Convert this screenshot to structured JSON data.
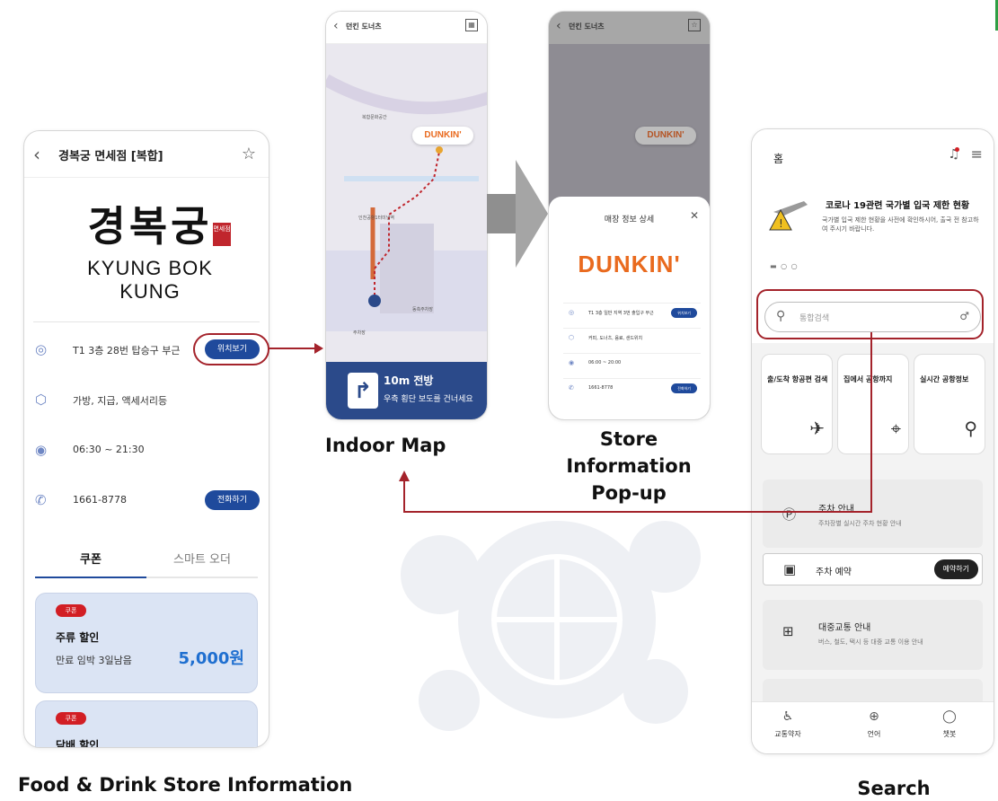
{
  "captions": {
    "food_store": "Food & Drink Store Information",
    "indoor_map": "Indoor Map",
    "store_popup": "Store Information Pop-up",
    "search": "Search"
  },
  "store_screen": {
    "title": "경복궁 면세점 [복합]",
    "logo_korean": "경복궁",
    "logo_seal": "면세점",
    "logo_english": "KYUNG BOK KUNG",
    "rows": [
      {
        "icon": "location-pin-icon",
        "text": "T1 3층 28번 탑승구 부근",
        "button": "위치보기"
      },
      {
        "icon": "box-icon",
        "text": "가방, 지급, 액세서리등",
        "button": ""
      },
      {
        "icon": "clock-icon",
        "text": "06:30 ~ 21:30",
        "button": ""
      },
      {
        "icon": "phone-icon",
        "text": "1661-8778",
        "button": "전화하기"
      }
    ],
    "tabs": [
      "쿠폰",
      "스마트 오더"
    ],
    "coupons": [
      {
        "tag": "쿠폰",
        "title": "주류 할인",
        "subtitle": "만료 임박  3일남음",
        "amount": "5,000원"
      },
      {
        "tag": "쿠폰",
        "title": "담배 할인",
        "subtitle": "",
        "amount": ""
      }
    ]
  },
  "map_screen": {
    "title": "던킨 도너츠",
    "callout": "DUNKIN'",
    "labels": [
      "복합문화공간",
      "인천공항1터미널역",
      "주차장",
      "동측주차장"
    ],
    "nav_distance": "10m 전방",
    "nav_instruction": "우측 횡단 보도를 건너세요"
  },
  "popup_screen": {
    "title": "던킨 도너츠",
    "popup_title": "매장 정보 상세",
    "brand": "DUNKIN'",
    "rows": [
      {
        "text": "T1 3층 일반 지역 3번 출입구 부근",
        "button": "위치보기"
      },
      {
        "text": "커피, 도너츠, 음료, 샌드위치",
        "button": ""
      },
      {
        "text": "06:00 ~ 20:00",
        "button": ""
      },
      {
        "text": "1661-8778",
        "button": "전화하기"
      }
    ]
  },
  "home_screen": {
    "title": "홈",
    "notice_title": "코로나 19관련 국가별 입국 제한 현황",
    "notice_body": "국가별 입국 제한 현황을 사전에 확인하시어, 출국 전 참고하여 주시기 바랍니다.",
    "search_placeholder": "통합검색",
    "cards": [
      {
        "title": "출/도착 항공편 검색",
        "icon": "airplane-icon"
      },
      {
        "title": "집에서 공항까지",
        "icon": "route-icon"
      },
      {
        "title": "실시간 공항정보",
        "icon": "magnifier-icon"
      }
    ],
    "parking_title": "주차 안내",
    "parking_sub": "주차장별 실시간 주차 현황 안내",
    "reservation_title": "주차 예약",
    "reservation_button": "예약하기",
    "transit_title": "대중교통 안내",
    "transit_sub": "버스, 철도, 택시 등 대중 교통 이용 안내",
    "tabbar": [
      {
        "label": "교통약자",
        "icon": "wheelchair-icon"
      },
      {
        "label": "언어",
        "icon": "globe-icon"
      },
      {
        "label": "챗봇",
        "icon": "chat-icon"
      }
    ]
  },
  "colors": {
    "brand_blue": "#1f4a9c",
    "highlight_red": "#a4232b",
    "dunkin_orange": "#e96a1e",
    "coupon_red": "#d21e24"
  }
}
